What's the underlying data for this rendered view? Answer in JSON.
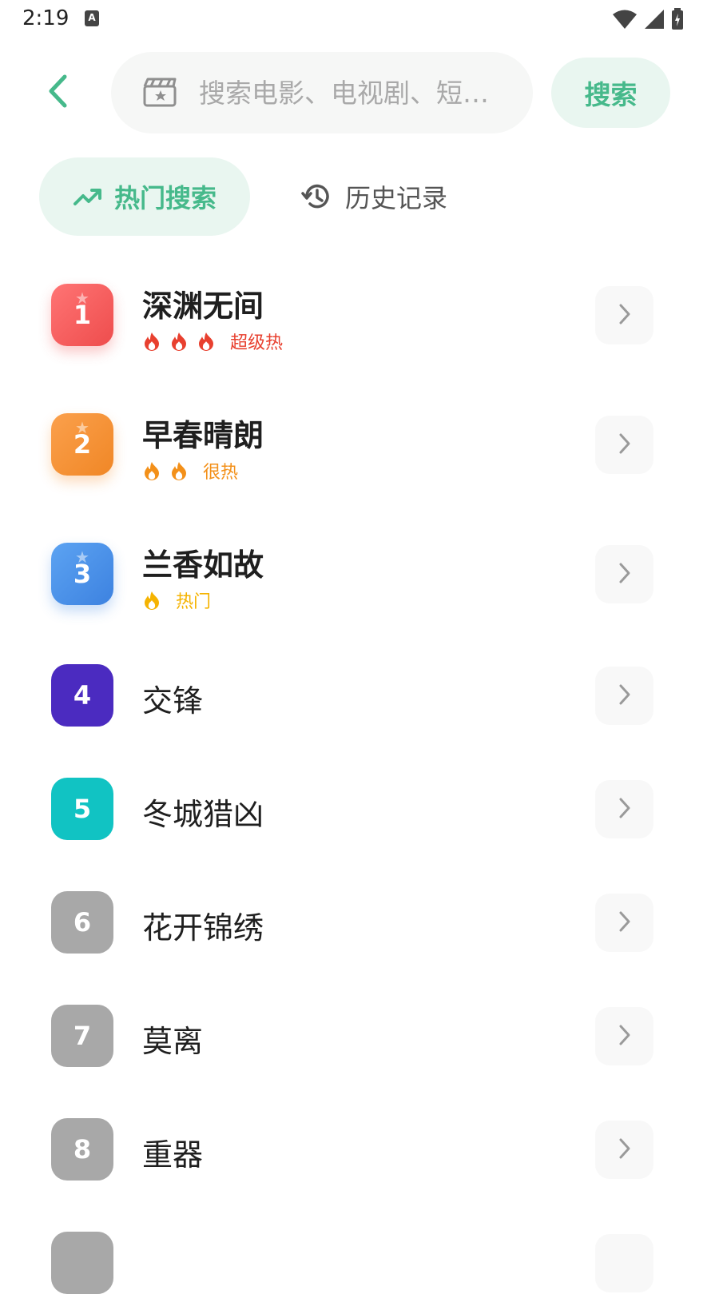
{
  "status_bar": {
    "time": "2:19",
    "notif_letter": "A"
  },
  "search": {
    "placeholder": "搜索电影、电视剧、短…",
    "value": "",
    "button_label": "搜索"
  },
  "tabs": [
    {
      "label": "热门搜索",
      "active": true
    },
    {
      "label": "历史记录",
      "active": false
    }
  ],
  "colors": {
    "accent": "#46b98b",
    "accent_bg": "#e9f6f0"
  },
  "items": [
    {
      "rank": "1",
      "title": "深渊无间",
      "heat_label": "超级热",
      "flames": 3,
      "color": "#f25c5c",
      "heat_color": "#e8402f"
    },
    {
      "rank": "2",
      "title": "早春晴朗",
      "heat_label": "很热",
      "flames": 2,
      "color": "#f5902e",
      "heat_color": "#f39019"
    },
    {
      "rank": "3",
      "title": "兰香如故",
      "heat_label": "热门",
      "flames": 1,
      "color": "#4a90e8",
      "heat_color": "#f5b301"
    },
    {
      "rank": "4",
      "title": "交锋",
      "color": "#4b2bc0"
    },
    {
      "rank": "5",
      "title": "冬城猎凶",
      "color": "#11c3c3"
    },
    {
      "rank": "6",
      "title": "花开锦绣",
      "color": "#a8a8a8"
    },
    {
      "rank": "7",
      "title": "莫离",
      "color": "#a8a8a8"
    },
    {
      "rank": "8",
      "title": "重器",
      "color": "#a8a8a8"
    },
    {
      "rank": "",
      "title": "",
      "color": "#a8a8a8"
    }
  ]
}
